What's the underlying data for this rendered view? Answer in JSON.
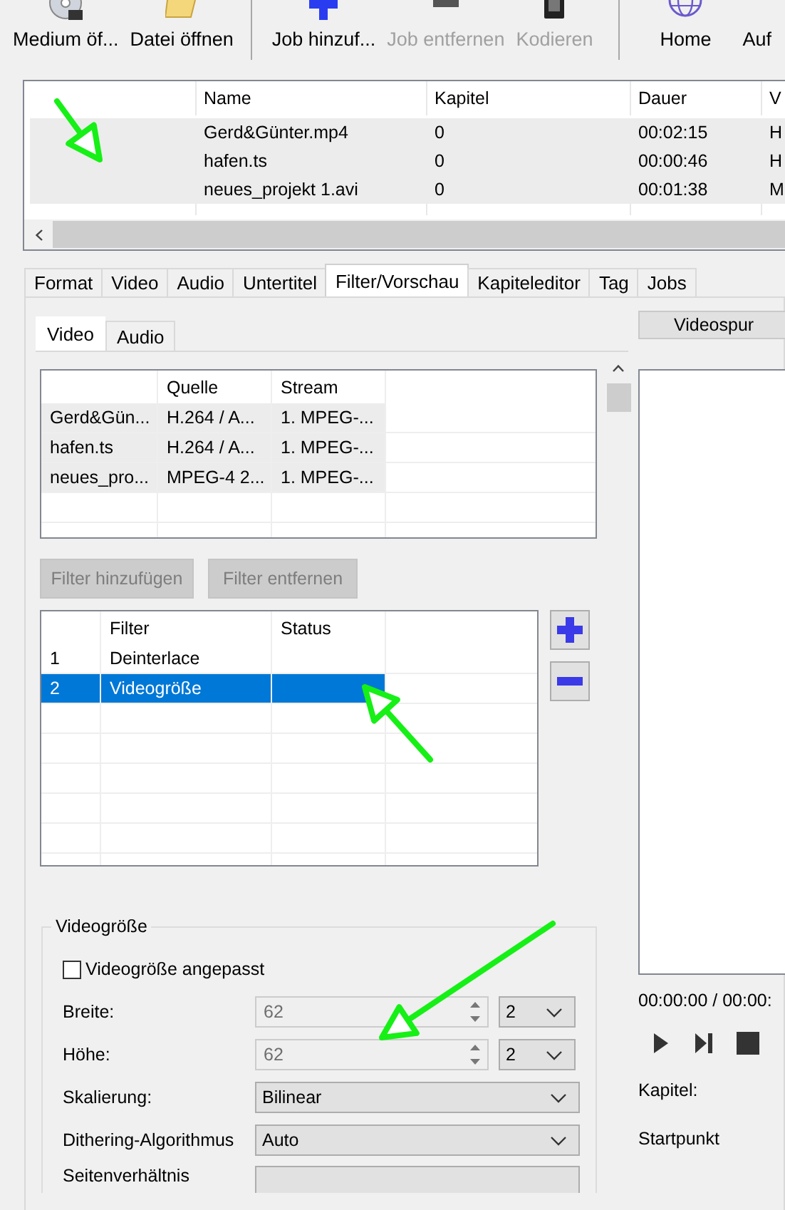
{
  "toolbar": [
    {
      "kind": "button",
      "label": "Medium öf...",
      "disabled": false
    },
    {
      "kind": "button",
      "label": "Datei öffnen",
      "disabled": false
    },
    {
      "kind": "separator"
    },
    {
      "kind": "button",
      "label": "Job hinzuf...",
      "disabled": false
    },
    {
      "kind": "button",
      "label": "Job entfernen",
      "disabled": true
    },
    {
      "kind": "button",
      "label": "Kodieren",
      "disabled": true
    },
    {
      "kind": "separator"
    },
    {
      "kind": "button",
      "label": "Home",
      "disabled": false
    },
    {
      "kind": "button",
      "label": "Auf",
      "disabled": false
    }
  ],
  "jobs_table": {
    "columns": [
      "Name",
      "Kapitel",
      "Dauer",
      "V"
    ],
    "rows": [
      {
        "cells": [
          "Gerd&Günter.mp4",
          "0",
          "00:02:15",
          "H"
        ]
      },
      {
        "cells": [
          "hafen.ts",
          "0",
          "00:00:46",
          "H"
        ]
      },
      {
        "cells": [
          "neues_projekt 1.avi",
          "0",
          "00:01:38",
          "M"
        ]
      }
    ]
  },
  "tabs": [
    {
      "label": "Format",
      "selected": false
    },
    {
      "label": "Video",
      "selected": false
    },
    {
      "label": "Audio",
      "selected": false
    },
    {
      "label": "Untertitel",
      "selected": false
    },
    {
      "label": "Filter/Vorschau",
      "selected": true
    },
    {
      "label": "Kapiteleditor",
      "selected": false
    },
    {
      "label": "Tag",
      "selected": false
    },
    {
      "label": "Jobs",
      "selected": false
    }
  ],
  "subtabs": [
    {
      "label": "Video",
      "selected": true
    },
    {
      "label": "Audio",
      "selected": false
    }
  ],
  "source_table": {
    "columns": [
      "",
      "Quelle",
      "Stream"
    ],
    "rows": [
      {
        "cells": [
          "Gerd&Gün...",
          "H.264 / A...",
          "1. MPEG-..."
        ]
      },
      {
        "cells": [
          "hafen.ts",
          "H.264 / A...",
          "1. MPEG-..."
        ]
      },
      {
        "cells": [
          "neues_pro...",
          "MPEG-4 2...",
          "1. MPEG-..."
        ]
      }
    ]
  },
  "filter_buttons": [
    {
      "label": "Filter hinzufügen",
      "disabled": true
    },
    {
      "label": "Filter entfernen",
      "disabled": true
    }
  ],
  "filter_table": {
    "columns": [
      "Filter",
      "Status"
    ],
    "rows": [
      {
        "number": "1",
        "filter": "Deinterlace",
        "selected": false
      },
      {
        "number": "2",
        "filter": "Videogröße",
        "selected": true
      }
    ]
  },
  "video_size": {
    "title": "Videogröße",
    "checkbox": {
      "label": "Videogröße angepasst",
      "checked": false
    },
    "fields": [
      {
        "kind": "spin",
        "label": "Breite:",
        "value": "62",
        "disabled": true,
        "step": "2"
      },
      {
        "kind": "spin",
        "label": "Höhe:",
        "value": "62",
        "disabled": true,
        "step": "2"
      },
      {
        "kind": "select",
        "label": "Skalierung:",
        "value": "Bilinear"
      },
      {
        "kind": "select",
        "label": "Dithering-Algorithmus",
        "value": "Auto"
      },
      {
        "kind": "select",
        "label": "Seitenverhältnis"
      }
    ]
  },
  "preview": {
    "track_button": "Videospur",
    "time": "00:00:00 / 00:00:",
    "labels": [
      "Kapitel:",
      "Startpunkt"
    ]
  }
}
